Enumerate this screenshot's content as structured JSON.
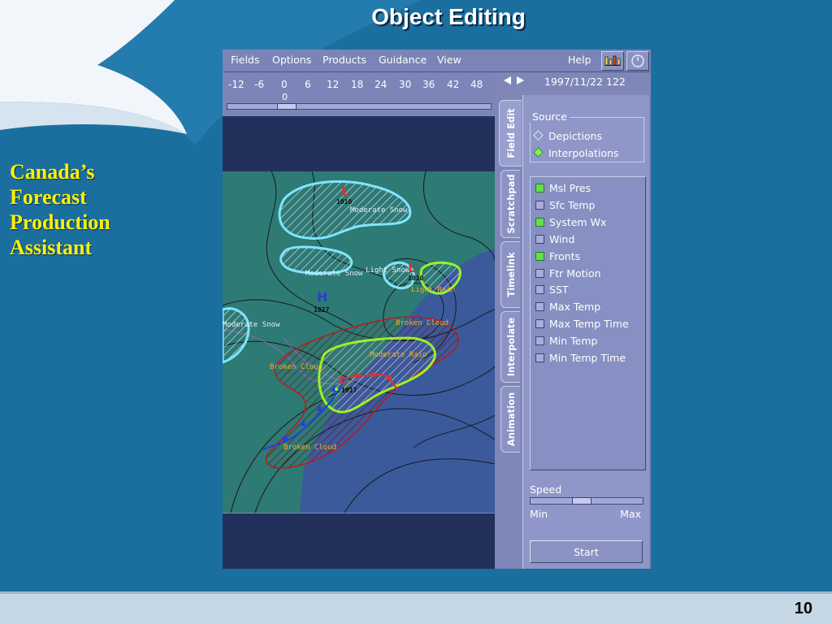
{
  "slide": {
    "title": "Object Editing",
    "side_title": [
      "Canada’s",
      "Forecast",
      "Production",
      "Assistant"
    ],
    "page_number": "10"
  },
  "colors": {
    "slide_background": "#1b6f9f",
    "title_text": "#ffffff",
    "side_title_text": "#fff200",
    "window_frame": "#7e87b8",
    "map_land": "#2e7a74",
    "map_water": "#3a5a9c",
    "checked_green": "#5fe04c",
    "snow_outline": "#7fe6ff",
    "rain_outline": "#9cf028",
    "cloud_outline": "#b02020",
    "low_symbol": "#e03030",
    "high_symbol": "#2840c8"
  },
  "menubar": {
    "items": [
      "Fields",
      "Options",
      "Products",
      "Guidance",
      "View"
    ],
    "help": "Help",
    "icons": [
      "bar-graph-icon",
      "clock-icon"
    ]
  },
  "timebar": {
    "ticks": [
      "-12",
      "-6",
      "0",
      "6",
      "12",
      "18",
      "24",
      "30",
      "36",
      "42",
      "48"
    ],
    "current": "0",
    "date": "1997/11/22  122"
  },
  "tabs": [
    "Field Edit",
    "Scratchpad",
    "Timelink",
    "Interpolate",
    "Animation"
  ],
  "source": {
    "title": "Source",
    "options": [
      {
        "label": "Depictions",
        "selected": false
      },
      {
        "label": "Interpolations",
        "selected": true
      }
    ]
  },
  "fields": [
    {
      "label": "Msl Pres",
      "checked": true
    },
    {
      "label": "Sfc Temp",
      "checked": false
    },
    {
      "label": "System Wx",
      "checked": true
    },
    {
      "label": "Wind",
      "checked": false
    },
    {
      "label": "Fronts",
      "checked": true
    },
    {
      "label": "Ftr Motion",
      "checked": false
    },
    {
      "label": "SST",
      "checked": false
    },
    {
      "label": "Max Temp",
      "checked": false
    },
    {
      "label": "Max Temp Time",
      "checked": false
    },
    {
      "label": "Min Temp",
      "checked": false
    },
    {
      "label": "Min Temp Time",
      "checked": false
    }
  ],
  "speed": {
    "label": "Speed",
    "min": "Min",
    "max": "Max",
    "level": 0.45
  },
  "start_label": "Start",
  "map": {
    "labels": {
      "snow1": "Moderate Snow",
      "snow2": "Moderate Snow",
      "snow3": "Light Snow",
      "snow4": "Moderate Snow",
      "rain_light": "Light Rain",
      "rain_mod": "Moderate Rain",
      "cloud1": "Broken Cloud",
      "cloud2": "Broken Cloud",
      "cloud3": "Broken Cloud"
    },
    "lows": [
      {
        "letter": "L",
        "pressure": "1010"
      },
      {
        "letter": "L",
        "pressure": "1010"
      },
      {
        "letter": "L",
        "pressure": "1017"
      }
    ],
    "high": {
      "letter": "H",
      "pressure": "1027"
    }
  }
}
